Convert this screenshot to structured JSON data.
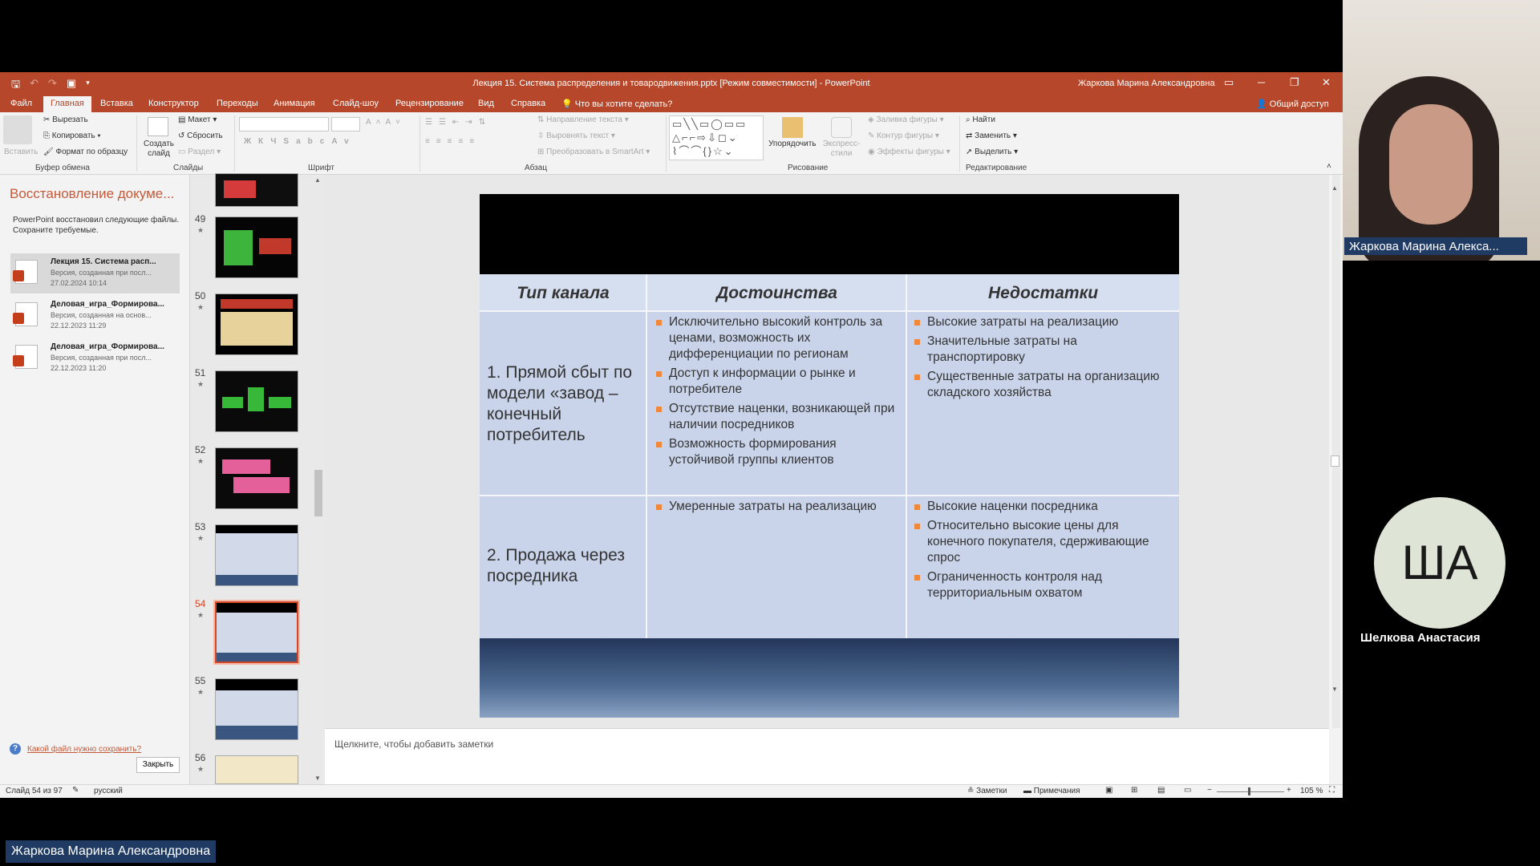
{
  "window": {
    "title": "Лекция 15. Система распределения и товародвижения.pptx [Режим совместимости] - PowerPoint",
    "user": "Жаркова Марина Александровна"
  },
  "tabs": [
    "Файл",
    "Главная",
    "Вставка",
    "Конструктор",
    "Переходы",
    "Анимация",
    "Слайд-шоу",
    "Рецензирование",
    "Вид",
    "Справка"
  ],
  "tell_me": "Что вы хотите сделать?",
  "share": "Общий доступ",
  "ribbon": {
    "paste": "Вставить",
    "cut": "Вырезать",
    "copy": "Копировать",
    "format_painter": "Формат по образцу",
    "clipboard_group": "Буфер обмена",
    "new_slide": "Создать слайд",
    "layout": "Макет",
    "reset": "Сбросить",
    "section": "Раздел",
    "slides_group": "Слайды",
    "font_group": "Шрифт",
    "text_direction": "Направление текста",
    "align_text": "Выровнять текст",
    "smartart": "Преобразовать в SmartArt",
    "paragraph_group": "Абзац",
    "arrange": "Упорядочить",
    "quick_styles": "Экспресс-стили",
    "shape_fill": "Заливка фигуры",
    "shape_outline": "Контур фигуры",
    "shape_effects": "Эффекты фигуры",
    "drawing_group": "Рисование",
    "find": "Найти",
    "replace": "Заменить",
    "select": "Выделить",
    "editing_group": "Редактирование"
  },
  "recovery": {
    "title": "Восстановление докуме...",
    "description": "PowerPoint восстановил следующие файлы. Сохраните требуемые.",
    "items": [
      {
        "name": "Лекция 15. Система расп...",
        "sub": "Версия, созданная при посл...",
        "date": "27.02.2024 10:14"
      },
      {
        "name": "Деловая_игра_Формирова...",
        "sub": "Версия, созданная на основ...",
        "date": "22.12.2023 11:29"
      },
      {
        "name": "Деловая_игра_Формирова...",
        "sub": "Версия, созданная при посл...",
        "date": "22.12.2023 11:20"
      }
    ],
    "help_link": "Какой файл нужно сохранить?",
    "close": "Закрыть"
  },
  "thumbnails": [
    "49",
    "50",
    "51",
    "52",
    "53",
    "54",
    "55",
    "56"
  ],
  "slide": {
    "headers": [
      "Тип канала",
      "Достоинства",
      "Недостатки"
    ],
    "row1": {
      "type": "1. Прямой сбыт по модели «завод – конечный потребитель",
      "pros": [
        "Исключительно высокий контроль за ценами, возможность их дифференциации по регионам",
        "Доступ к информации о рынке и потребителе",
        "Отсутствие наценки, возникающей при наличии посредников",
        "Возможность формирования устойчивой группы клиентов"
      ],
      "cons": [
        "Высокие затраты на реализацию",
        "Значительные затраты на транспортировку",
        "Существенные затраты на организацию складского хозяйства"
      ]
    },
    "row2": {
      "type": "2. Продажа через посредника",
      "pros": [
        "Умеренные затраты на реализацию"
      ],
      "cons": [
        "Высокие наценки посредника",
        "Относительно высокие цены для конечного покупателя, сдерживающие спрос",
        "Ограниченность контроля над территориальным охватом"
      ]
    }
  },
  "notes_placeholder": "Щелкните, чтобы добавить заметки",
  "status": {
    "slide_count": "Слайд 54 из 97",
    "language": "русский",
    "notes": "Заметки",
    "comments": "Примечания",
    "zoom": "105 %"
  },
  "participants": {
    "presenter_label": "Жаркова Марина Алекса...",
    "avatar_initials": "ША",
    "participant_name": "Шелкова Анастасия",
    "bottom_label": "Жаркова Марина Александровна"
  }
}
